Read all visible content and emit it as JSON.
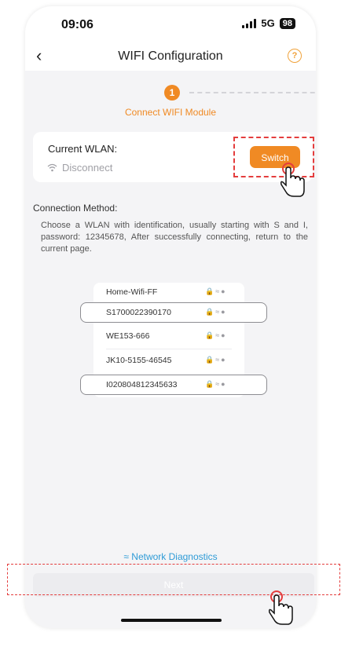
{
  "status_bar": {
    "time": "09:06",
    "network": "5G",
    "battery": "98"
  },
  "header": {
    "back_icon": "chevron-left-icon",
    "title": "WIFI Configuration",
    "help_icon": "question-circle-icon"
  },
  "steps": {
    "current_number": "1",
    "current_label": "Connect WIFI Module"
  },
  "current_wlan": {
    "title": "Current WLAN:",
    "status": "Disconnect",
    "switch_label": "Switch"
  },
  "connection_method": {
    "title": "Connection Method:",
    "description": "Choose a WLAN with identification, usually starting with S and I, password: 12345678, After successfully connecting, return to the current page."
  },
  "wifi_list": [
    {
      "name": "Home-Wifi-FF",
      "highlighted": false
    },
    {
      "name": "S1700022390170",
      "highlighted": true
    },
    {
      "name": "WE153-666",
      "highlighted": false
    },
    {
      "name": "JK10-5155-46545",
      "highlighted": false
    },
    {
      "name": "I020804812345633",
      "highlighted": true
    }
  ],
  "footer": {
    "diagnostics_label": "Network Diagnostics",
    "next_label": "Next"
  },
  "colors": {
    "accent": "#f08a24",
    "link": "#2e9bd6",
    "highlight": "#e43d3d",
    "background": "#f4f4f6"
  }
}
